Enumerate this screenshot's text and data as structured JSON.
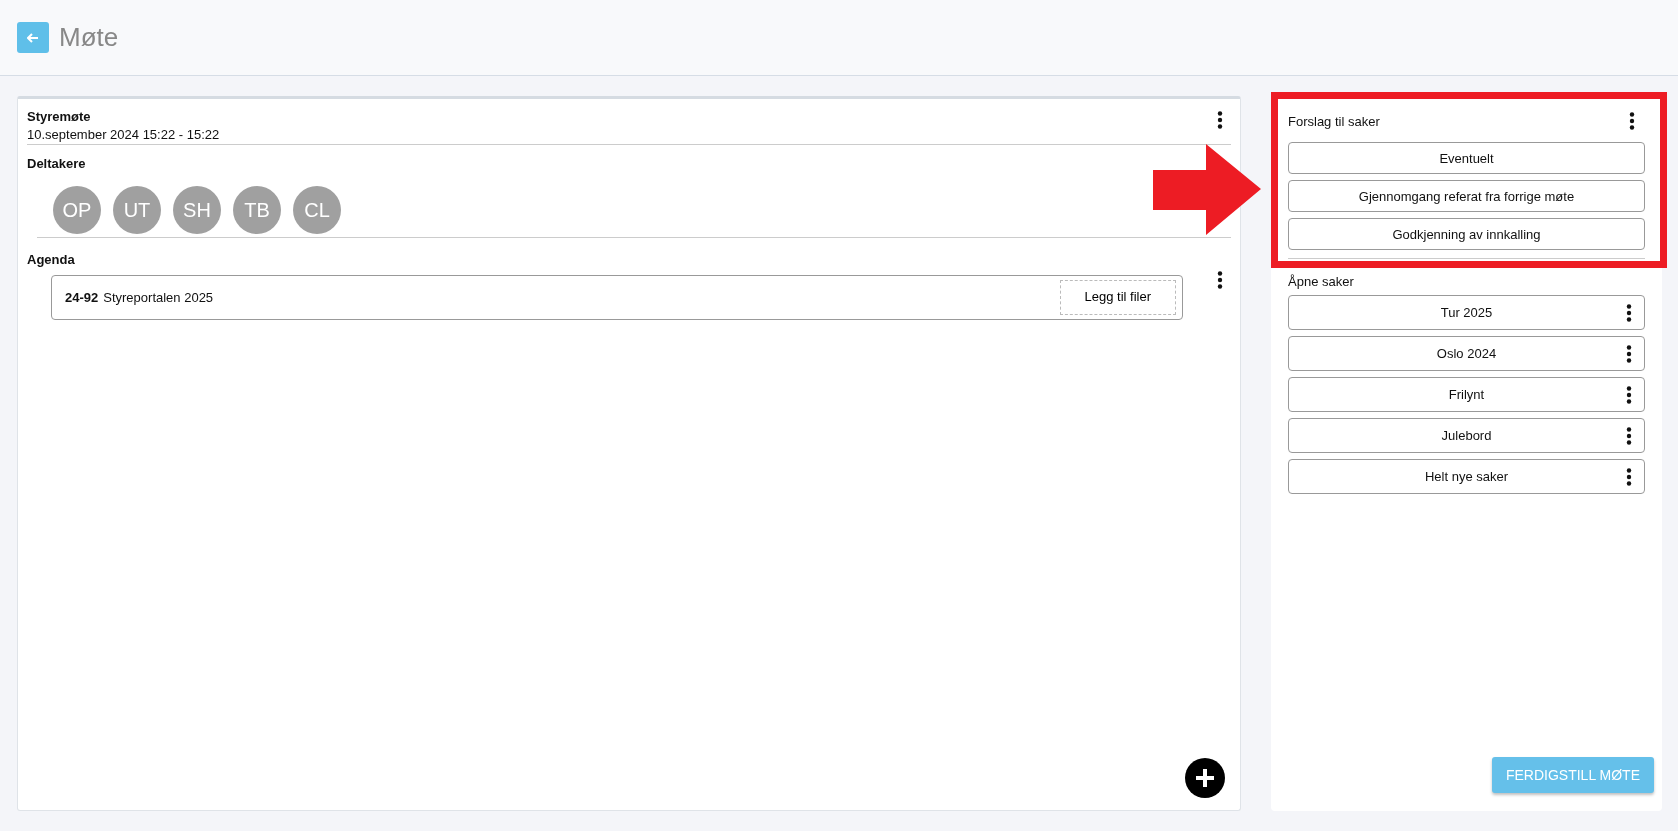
{
  "header": {
    "title": "Møte"
  },
  "meeting": {
    "title": "Styremøte",
    "datetime": "10.september 2024 15:22 - 15:22",
    "participants_label": "Deltakere",
    "participants": [
      "OP",
      "UT",
      "SH",
      "TB",
      "CL"
    ],
    "agenda_label": "Agenda",
    "agenda": [
      {
        "number": "24-92",
        "title": "Styreportalen 2025",
        "attach": "Legg til filer"
      }
    ]
  },
  "suggestions": {
    "title": "Forslag til saker",
    "items": [
      "Eventuelt",
      "Gjennomgang referat fra forrige møte",
      "Godkjenning av innkalling"
    ]
  },
  "open_cases": {
    "title": "Åpne saker",
    "items": [
      "Tur 2025",
      "Oslo 2024",
      "Frilynt",
      "Julebord",
      "Helt nye saker"
    ]
  },
  "finish_button": "FERDIGSTILL MØTE"
}
